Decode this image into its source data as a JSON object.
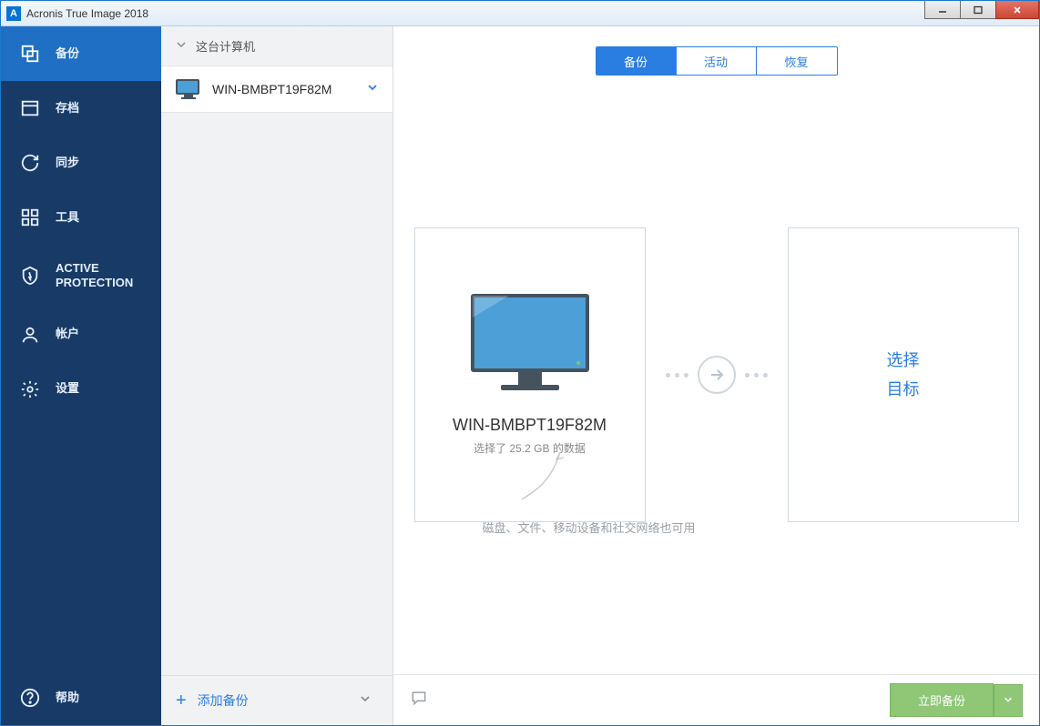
{
  "window": {
    "title": "Acronis True Image 2018",
    "icon_letter": "A"
  },
  "sidebar": {
    "items": [
      {
        "id": "backup",
        "label": "备份",
        "icon": "copy-icon"
      },
      {
        "id": "archive",
        "label": "存档",
        "icon": "archive-icon"
      },
      {
        "id": "sync",
        "label": "同步",
        "icon": "sync-icon"
      },
      {
        "id": "tools",
        "label": "工具",
        "icon": "tools-icon"
      },
      {
        "id": "active-protection",
        "label": "ACTIVE PROTECTION",
        "icon": "shield-icon"
      },
      {
        "id": "account",
        "label": "帐户",
        "icon": "account-icon"
      },
      {
        "id": "settings",
        "label": "设置",
        "icon": "gear-icon"
      }
    ],
    "help": {
      "label": "帮助",
      "icon": "help-icon"
    }
  },
  "listcol": {
    "header": "这台计算机",
    "items": [
      {
        "label": "WIN-BMBPT19F82M"
      }
    ],
    "add_label": "添加备份"
  },
  "main": {
    "tabs": [
      {
        "id": "backup",
        "label": "备份"
      },
      {
        "id": "activity",
        "label": "活动"
      },
      {
        "id": "recover",
        "label": "恢复"
      }
    ],
    "source_card": {
      "title": "WIN-BMBPT19F82M",
      "subtitle": "选择了 25.2 GB 的数据"
    },
    "dest_card": {
      "line1": "选择",
      "line2": "目标"
    },
    "hint": "磁盘、文件、移动设备和社交网络也可用",
    "go_button": "立即备份"
  }
}
